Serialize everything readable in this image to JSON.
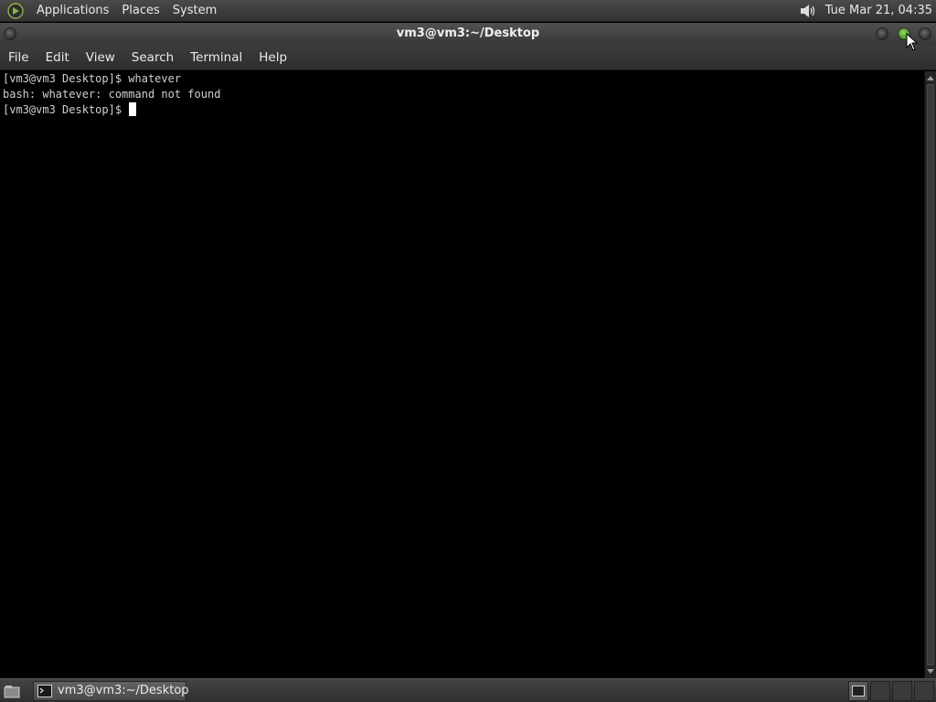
{
  "top_panel": {
    "menus": [
      "Applications",
      "Places",
      "System"
    ],
    "clock": "Tue Mar 21, 04:35",
    "icons": {
      "logo": "distro-logo-icon",
      "volume": "volume-icon"
    }
  },
  "window": {
    "title": "vm3@vm3:~/Desktop",
    "title_color": "#f0f0f0",
    "maximize_button_color": "#3a8c1c"
  },
  "menubar": {
    "items": [
      "File",
      "Edit",
      "View",
      "Search",
      "Terminal",
      "Help"
    ]
  },
  "terminal": {
    "background": "#000000",
    "foreground": "#d0d0d0",
    "lines": [
      "[vm3@vm3 Desktop]$ whatever",
      "bash: whatever: command not found",
      "[vm3@vm3 Desktop]$ "
    ]
  },
  "bottom_panel": {
    "task_button_label": "vm3@vm3:~/Desktop",
    "icons": {
      "show_desktop": "show-desktop-icon",
      "task": "terminal-icon"
    }
  }
}
